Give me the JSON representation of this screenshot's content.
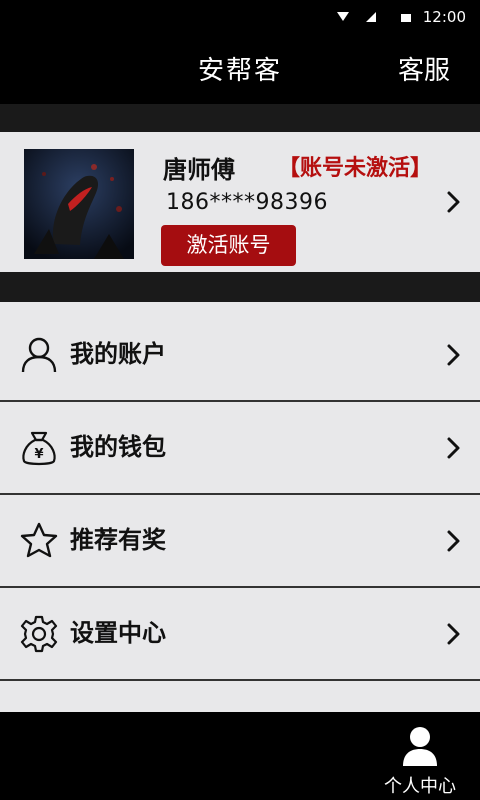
{
  "status_bar": {
    "time": "12:00",
    "icons": [
      "wifi-icon",
      "signal-icon",
      "battery-icon"
    ]
  },
  "header": {
    "title": "安帮客",
    "service_label": "客服"
  },
  "profile": {
    "name": "唐师傅",
    "account_status": "【账号未激活】",
    "phone": "186****98396",
    "activate_label": "激活账号"
  },
  "menu": {
    "items": [
      {
        "label": "我的账户",
        "icon": "user-icon"
      },
      {
        "label": "我的钱包",
        "icon": "money-bag-icon"
      },
      {
        "label": "推荐有奖",
        "icon": "star-icon"
      },
      {
        "label": "设置中心",
        "icon": "gear-icon"
      }
    ]
  },
  "bottom_nav": {
    "personal_label": "个人中心"
  },
  "colors": {
    "accent": "#a50d10",
    "status_text": "#b50f0f",
    "panel": "#e8e8ea",
    "header_bg": "#000000"
  }
}
